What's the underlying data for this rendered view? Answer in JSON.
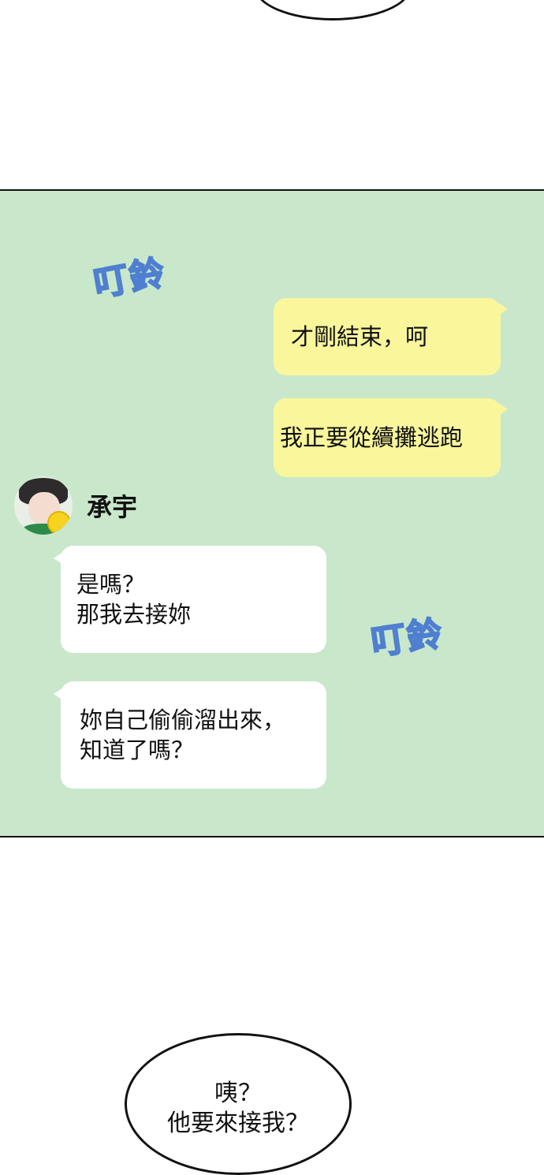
{
  "sound_effects": [
    "叮鈴",
    "叮鈴"
  ],
  "contact": {
    "name": "承宇"
  },
  "messages": [
    {
      "side": "outgoing",
      "text": "才剛結束，呵"
    },
    {
      "side": "outgoing",
      "text": "我正要從續攤逃跑"
    },
    {
      "side": "incoming",
      "text": "是嗎？\n那我去接妳"
    },
    {
      "side": "incoming",
      "text": "妳自己偷偷溜出來，\n知道了嗎？"
    }
  ],
  "speech_bubble_bottom": {
    "text": "咦？\n他要來接我？"
  },
  "colors": {
    "panel_bg": "#c9e8cb",
    "outgoing_bubble": "#faf69c",
    "incoming_bubble": "#ffffff",
    "sfx_outline": "#4f7fd0"
  }
}
